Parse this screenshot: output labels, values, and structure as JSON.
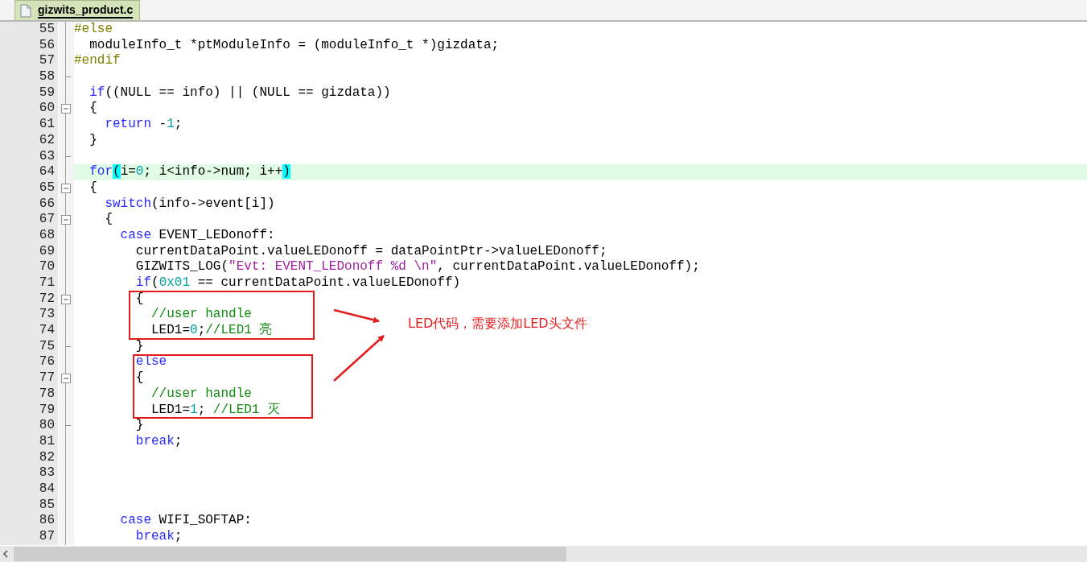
{
  "tabs": [
    {
      "label": "gizwits_product.c",
      "selected": true
    }
  ],
  "lines": [
    {
      "number": "55",
      "foldable": false,
      "fold_end": false,
      "current": false,
      "segments": [
        {
          "kind": "preproc",
          "text": "#else"
        }
      ]
    },
    {
      "number": "56",
      "foldable": false,
      "fold_end": false,
      "current": false,
      "segments": [
        {
          "kind": "plain",
          "text": "  moduleInfo_t *ptModuleInfo = (moduleInfo_t *)gizdata;"
        }
      ]
    },
    {
      "number": "57",
      "foldable": false,
      "fold_end": false,
      "current": false,
      "segments": [
        {
          "kind": "preproc",
          "text": "#endif"
        }
      ]
    },
    {
      "number": "58",
      "foldable": false,
      "fold_end": true,
      "current": false
    },
    {
      "number": "59",
      "foldable": false,
      "fold_end": false,
      "current": false,
      "segments": [
        {
          "kind": "keyword",
          "text": "  if"
        },
        {
          "kind": "plain",
          "text": "((NULL == info) || (NULL == gizdata))"
        }
      ]
    },
    {
      "number": "60",
      "foldable": true,
      "fold_end": false,
      "current": false,
      "segments": [
        {
          "kind": "plain",
          "text": "  {"
        }
      ]
    },
    {
      "number": "61",
      "foldable": false,
      "fold_end": false,
      "current": false,
      "segments": [
        {
          "kind": "keyword",
          "text": "    return"
        },
        {
          "kind": "plain",
          "text": " -"
        },
        {
          "kind": "number",
          "text": "1"
        },
        {
          "kind": "plain",
          "text": ";"
        }
      ]
    },
    {
      "number": "62",
      "foldable": false,
      "fold_end": false,
      "current": false,
      "segments": [
        {
          "kind": "plain",
          "text": "  }"
        }
      ]
    },
    {
      "number": "63",
      "foldable": false,
      "fold_end": true,
      "current": false
    },
    {
      "number": "64",
      "foldable": false,
      "fold_end": false,
      "current": true,
      "segments": [
        {
          "kind": "keyword",
          "text": "  for"
        },
        {
          "kind": "match",
          "text": "("
        },
        {
          "kind": "plain",
          "text": "i="
        },
        {
          "kind": "number",
          "text": "0"
        },
        {
          "kind": "plain",
          "text": "; i<info->num; i++"
        },
        {
          "kind": "match",
          "text": ")"
        }
      ]
    },
    {
      "number": "65",
      "foldable": true,
      "fold_end": false,
      "current": false,
      "segments": [
        {
          "kind": "plain",
          "text": "  {"
        }
      ]
    },
    {
      "number": "66",
      "foldable": false,
      "fold_end": false,
      "current": false,
      "segments": [
        {
          "kind": "keyword",
          "text": "    switch"
        },
        {
          "kind": "plain",
          "text": "(info->event[i])"
        }
      ]
    },
    {
      "number": "67",
      "foldable": true,
      "fold_end": false,
      "current": false,
      "segments": [
        {
          "kind": "plain",
          "text": "    {"
        }
      ]
    },
    {
      "number": "68",
      "foldable": false,
      "fold_end": false,
      "current": false,
      "segments": [
        {
          "kind": "keyword",
          "text": "      case"
        },
        {
          "kind": "plain",
          "text": " EVENT_LEDonoff:"
        }
      ]
    },
    {
      "number": "69",
      "foldable": false,
      "fold_end": false,
      "current": false,
      "segments": [
        {
          "kind": "plain",
          "text": "        currentDataPoint.valueLEDonoff = dataPointPtr->valueLEDonoff;"
        }
      ]
    },
    {
      "number": "70",
      "foldable": false,
      "fold_end": false,
      "current": false,
      "segments": [
        {
          "kind": "plain",
          "text": "        GIZWITS_LOG("
        },
        {
          "kind": "string",
          "text": "\"Evt: EVENT_LEDonoff %d \\n\""
        },
        {
          "kind": "plain",
          "text": ", currentDataPoint.valueLEDonoff);"
        }
      ]
    },
    {
      "number": "71",
      "foldable": false,
      "fold_end": false,
      "current": false,
      "segments": [
        {
          "kind": "keyword",
          "text": "        if"
        },
        {
          "kind": "plain",
          "text": "("
        },
        {
          "kind": "number",
          "text": "0x01"
        },
        {
          "kind": "plain",
          "text": " == currentDataPoint.valueLEDonoff)"
        }
      ]
    },
    {
      "number": "72",
      "foldable": true,
      "fold_end": false,
      "current": false,
      "segments": [
        {
          "kind": "plain",
          "text": "        {"
        }
      ]
    },
    {
      "number": "73",
      "foldable": false,
      "fold_end": false,
      "current": false,
      "segments": [
        {
          "kind": "comment",
          "text": "          //user handle"
        }
      ]
    },
    {
      "number": "74",
      "foldable": false,
      "fold_end": false,
      "current": false,
      "segments": [
        {
          "kind": "plain",
          "text": "          LED1="
        },
        {
          "kind": "number",
          "text": "0"
        },
        {
          "kind": "plain",
          "text": ";"
        },
        {
          "kind": "comment",
          "text": "//LED1 亮"
        }
      ]
    },
    {
      "number": "75",
      "foldable": false,
      "fold_end": true,
      "current": false,
      "segments": [
        {
          "kind": "plain",
          "text": "        }"
        }
      ]
    },
    {
      "number": "76",
      "foldable": false,
      "fold_end": false,
      "current": false,
      "segments": [
        {
          "kind": "keyword",
          "text": "        else"
        }
      ]
    },
    {
      "number": "77",
      "foldable": true,
      "fold_end": false,
      "current": false,
      "segments": [
        {
          "kind": "plain",
          "text": "        {"
        }
      ]
    },
    {
      "number": "78",
      "foldable": false,
      "fold_end": false,
      "current": false,
      "segments": [
        {
          "kind": "comment",
          "text": "          //user handle"
        }
      ]
    },
    {
      "number": "79",
      "foldable": false,
      "fold_end": false,
      "current": false,
      "segments": [
        {
          "kind": "plain",
          "text": "          LED1="
        },
        {
          "kind": "number",
          "text": "1"
        },
        {
          "kind": "plain",
          "text": "; "
        },
        {
          "kind": "comment",
          "text": "//LED1 灭"
        }
      ]
    },
    {
      "number": "80",
      "foldable": false,
      "fold_end": true,
      "current": false,
      "segments": [
        {
          "kind": "plain",
          "text": "        }"
        }
      ]
    },
    {
      "number": "81",
      "foldable": false,
      "fold_end": false,
      "current": false,
      "segments": [
        {
          "kind": "keyword",
          "text": "        break"
        },
        {
          "kind": "plain",
          "text": ";"
        }
      ]
    },
    {
      "number": "82",
      "foldable": false,
      "fold_end": false,
      "current": false
    },
    {
      "number": "83",
      "foldable": false,
      "fold_end": false,
      "current": false
    },
    {
      "number": "84",
      "foldable": false,
      "fold_end": false,
      "current": false
    },
    {
      "number": "85",
      "foldable": false,
      "fold_end": false,
      "current": false
    },
    {
      "number": "86",
      "foldable": false,
      "fold_end": false,
      "current": false,
      "segments": [
        {
          "kind": "keyword",
          "text": "      case"
        },
        {
          "kind": "plain",
          "text": " WIFI_SOFTAP:"
        }
      ]
    },
    {
      "number": "87",
      "foldable": false,
      "fold_end": false,
      "current": false,
      "segments": [
        {
          "kind": "keyword",
          "text": "        break"
        },
        {
          "kind": "plain",
          "text": ";"
        }
      ]
    }
  ],
  "annotation": {
    "note": "LED代码，需要添加LED头文件"
  }
}
